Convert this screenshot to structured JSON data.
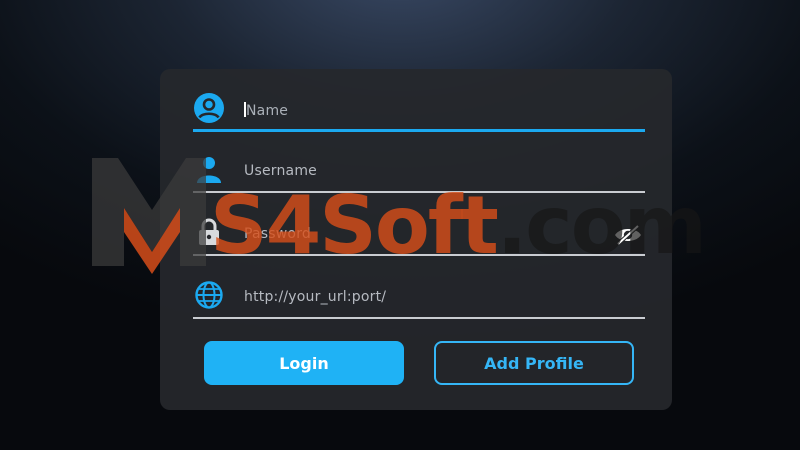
{
  "form": {
    "name_placeholder": "Name",
    "username_placeholder": "Username",
    "password_placeholder": "Password",
    "url_placeholder": "http://your_url:port/"
  },
  "buttons": {
    "login_label": "Login",
    "add_profile_label": "Add Profile"
  },
  "watermark": {
    "brand": "S4Soft",
    "domain": ".com",
    "logo_letter": "M"
  },
  "colors": {
    "accent": "#1fb2f5",
    "watermark_orange": "#d64e1a",
    "card_bg": "#26282c"
  },
  "icons": {
    "name": "user-circle-icon",
    "username": "user-icon",
    "password": "lock-icon",
    "url": "globe-icon",
    "visibility": "eye-off-icon"
  }
}
